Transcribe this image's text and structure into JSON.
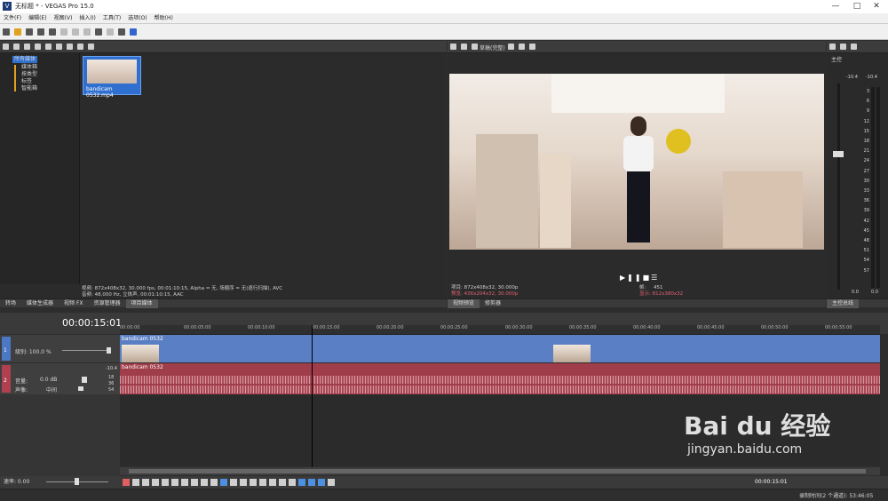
{
  "window": {
    "title": "无标题 * - VEGAS Pro 15.0",
    "app_icon": "V"
  },
  "menu": [
    "文件(F)",
    "编辑(E)",
    "视图(V)",
    "插入(I)",
    "工具(T)",
    "选项(O)",
    "帮助(H)"
  ],
  "explorer": {
    "tree": [
      "所有媒体",
      "媒体箱",
      "按类型",
      "标签",
      "智能箱"
    ],
    "file": "bandicam 0532.mp4",
    "status_line1": "视频: 872x408x32, 30.000 fps, 00:01:10:15, Alpha = 无, 场顺序 = 无(逐行扫描), AVC",
    "status_line2": "音频: 48,000 Hz, 立体声, 00:01:10:15, AAC",
    "tabs": [
      "转场",
      "媒体生成器",
      "视频 FX",
      "资源管理器",
      "项目媒体"
    ]
  },
  "preview": {
    "quality": "草稿(完整)",
    "project": "项目: 872x408x32, 30.000p",
    "preview": "预览: 436x204x32, 30.000p",
    "frame_label": "帧:",
    "frame_value": "451",
    "display": "显示: 812x380x32",
    "tabs": [
      "视频预览",
      "修剪器"
    ]
  },
  "mixer": {
    "label": "主控",
    "peak_left": "-10.4",
    "peak_right": "-10.4",
    "scale": [
      "3",
      "6",
      "9",
      "12",
      "15",
      "18",
      "21",
      "24",
      "27",
      "30",
      "33",
      "36",
      "39",
      "42",
      "45",
      "48",
      "51",
      "54",
      "57"
    ],
    "bottom_left": "0.0",
    "bottom_right": "0.0",
    "tab": "主控总线"
  },
  "timeline": {
    "timecode": "00:00:15:01",
    "ruler": [
      "00:00:00",
      "00:00:05:00",
      "00:00:10:00",
      "00:00:15:00",
      "00:00:20:00",
      "00:00:25:00",
      "00:00:30:00",
      "00:00:35:00",
      "00:00:40:00",
      "00:00:45:00",
      "00:00:50:00",
      "00:00:55:00"
    ],
    "video_track": {
      "number": "1",
      "level_label": "级别: 100.0 %",
      "clip_name": "bandicam 0532"
    },
    "audio_track": {
      "number": "2",
      "peak": "-10.4",
      "volume_label": "音量:",
      "volume_value": "0.0 dB",
      "pan_label": "声像:",
      "pan_value": "中间",
      "clip_name": "bandicam 0532",
      "db_marks": [
        "18",
        "36",
        "54"
      ]
    },
    "rate_label": "速率: 0.00",
    "cursor_time": "00:00:15:01"
  },
  "status": {
    "record_time": "录制时间(2 个通道): 53:46:05"
  },
  "watermark": {
    "text": "Bai du 经验",
    "url": "jingyan.baidu.com"
  }
}
